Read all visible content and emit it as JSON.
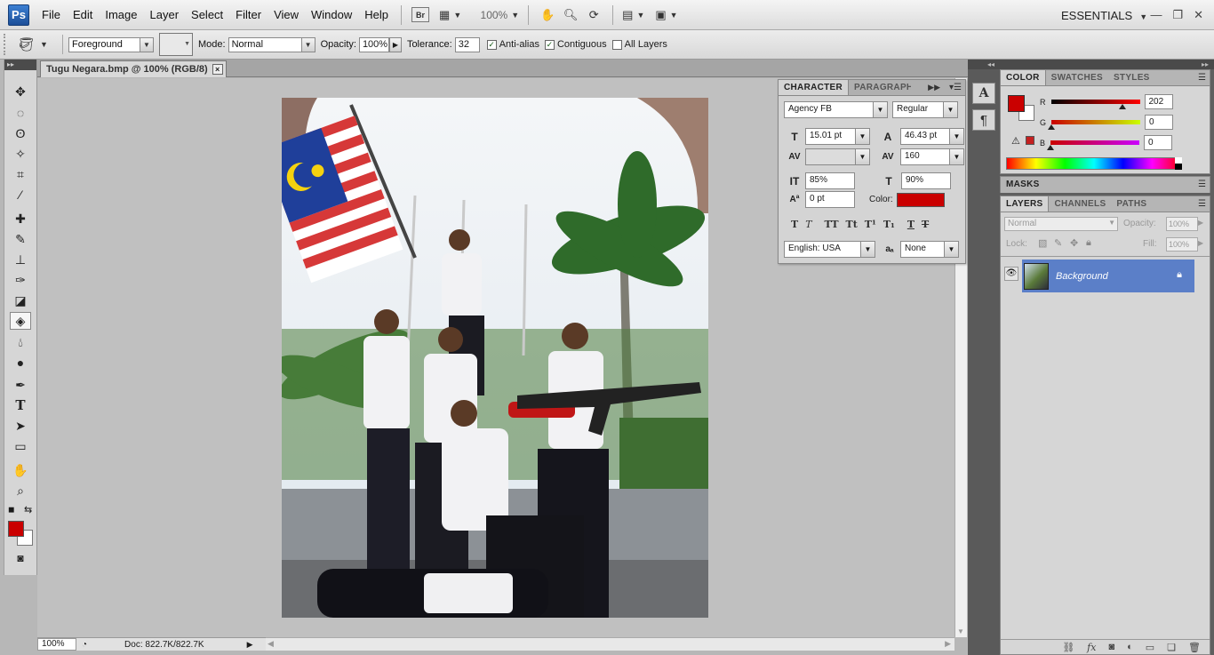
{
  "app": {
    "logo": "Ps",
    "workspace": "ESSENTIALS"
  },
  "menu": [
    "File",
    "Edit",
    "Image",
    "Layer",
    "Select",
    "Filter",
    "View",
    "Window",
    "Help"
  ],
  "appbar": {
    "bridge": "Br",
    "zoom": "100%"
  },
  "options": {
    "fill_source": "Foreground",
    "mode_label": "Mode:",
    "mode_value": "Normal",
    "opacity_label": "Opacity:",
    "opacity_value": "100%",
    "tolerance_label": "Tolerance:",
    "tolerance_value": "32",
    "antialias_label": "Anti-alias",
    "antialias_checked": true,
    "contiguous_label": "Contiguous",
    "contiguous_checked": true,
    "all_layers_label": "All Layers",
    "all_layers_checked": false
  },
  "document": {
    "tab_title": "Tugu Negara.bmp @ 100% (RGB/8)",
    "close": "×"
  },
  "status": {
    "zoom": "100%",
    "doc": "Doc: 822.7K/822.7K"
  },
  "character": {
    "tabs": [
      "CHARACTER",
      "PARAGRAPH"
    ],
    "font_family": "Agency FB",
    "font_style": "Regular",
    "font_size": "15.01 pt",
    "leading": "46.43 pt",
    "kerning": "",
    "tracking": "160",
    "vertical_scale": "85%",
    "horizontal_scale": "90%",
    "baseline_shift": "0 pt",
    "color_label": "Color:",
    "color_value": "#ca0000",
    "language": "English: USA",
    "antialias": "None",
    "format_buttons": [
      "T",
      "T",
      "TT",
      "Tt",
      "T¹",
      "T₁",
      "T",
      "T"
    ]
  },
  "color_panel": {
    "tabs": [
      "COLOR",
      "SWATCHES",
      "STYLES"
    ],
    "r_label": "R",
    "r_value": "202",
    "g_label": "G",
    "g_value": "0",
    "b_label": "B",
    "b_value": "0",
    "foreground": "#ca0000",
    "background": "#ffffff"
  },
  "masks_panel": {
    "title": "MASKS"
  },
  "layers_panel": {
    "tabs": [
      "LAYERS",
      "CHANNELS",
      "PATHS"
    ],
    "blend_mode": "Normal",
    "opacity_label": "Opacity:",
    "opacity_value": "100%",
    "lock_label": "Lock:",
    "fill_label": "Fill:",
    "fill_value": "100%",
    "layers": [
      {
        "name": "Background",
        "visible": true,
        "locked": true
      }
    ]
  },
  "colors": {
    "foreground": "#ca0000",
    "background": "#ffffff",
    "layer_selected": "#5b7fc8"
  }
}
